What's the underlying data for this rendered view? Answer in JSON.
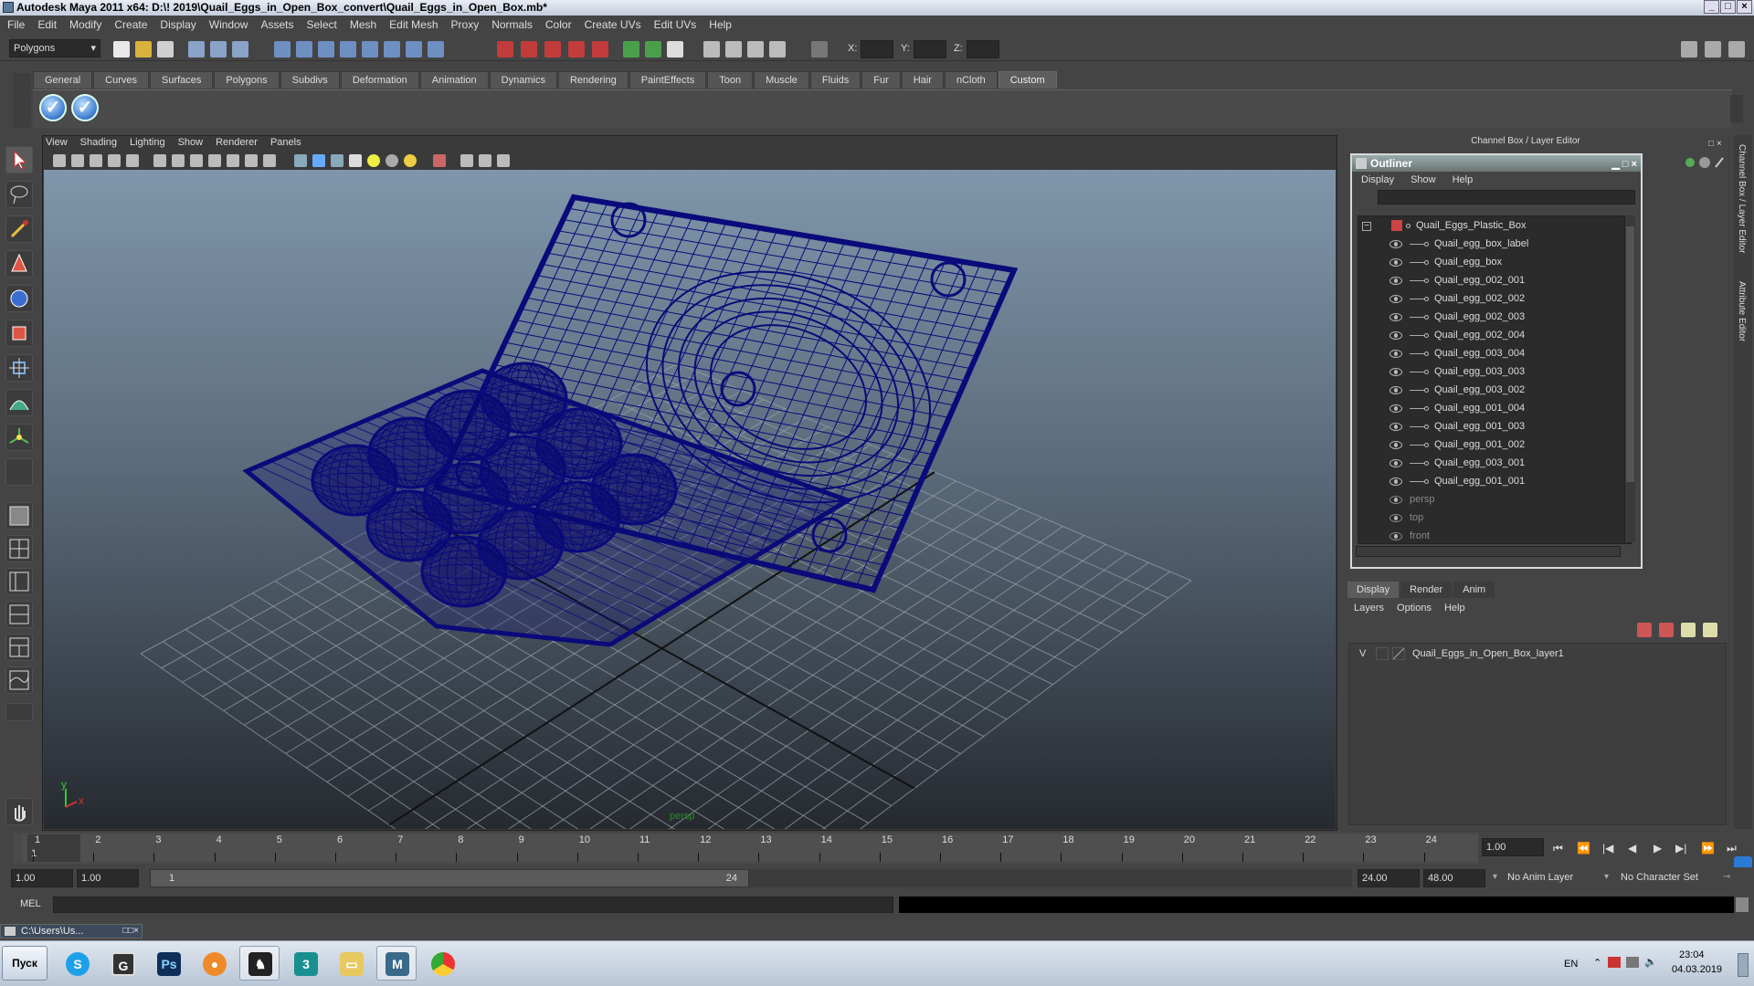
{
  "window": {
    "title": "Autodesk Maya 2011 x64: D:\\! 2019\\Quail_Eggs_in_Open_Box_convert\\Quail_Eggs_in_Open_Box.mb*"
  },
  "menubar": [
    "File",
    "Edit",
    "Modify",
    "Create",
    "Display",
    "Window",
    "Assets",
    "Select",
    "Mesh",
    "Edit Mesh",
    "Proxy",
    "Normals",
    "Color",
    "Create UVs",
    "Edit UVs",
    "Help"
  ],
  "status_line": {
    "mode_selector": "Polygons",
    "coord_x_label": "X:",
    "coord_y_label": "Y:",
    "coord_z_label": "Z:"
  },
  "shelf": {
    "tabs": [
      "General",
      "Curves",
      "Surfaces",
      "Polygons",
      "Subdivs",
      "Deformation",
      "Animation",
      "Dynamics",
      "Rendering",
      "PaintEffects",
      "Toon",
      "Muscle",
      "Fluids",
      "Fur",
      "Hair",
      "nCloth",
      "Custom"
    ],
    "active_tab": "Custom"
  },
  "viewport": {
    "menu": [
      "View",
      "Shading",
      "Lighting",
      "Show",
      "Renderer",
      "Panels"
    ],
    "camera_label": "persp",
    "axis_y": "y",
    "axis_x": "x",
    "wire_color": "#0a0a7a"
  },
  "channel_box": {
    "title": "Channel Box / Layer Editor",
    "side_tabs": [
      "Channel Box / Layer Editor",
      "Attribute Editor"
    ]
  },
  "outliner": {
    "title": "Outliner",
    "menu": [
      "Display",
      "Show",
      "Help"
    ],
    "root": "Quail_Eggs_Plastic_Box",
    "children": [
      "Quail_egg_box_label",
      "Quail_egg_box",
      "Quail_egg_002_001",
      "Quail_egg_002_002",
      "Quail_egg_002_003",
      "Quail_egg_002_004",
      "Quail_egg_003_004",
      "Quail_egg_003_003",
      "Quail_egg_003_002",
      "Quail_egg_001_004",
      "Quail_egg_001_003",
      "Quail_egg_001_002",
      "Quail_egg_003_001",
      "Quail_egg_001_001"
    ],
    "cameras": [
      "persp",
      "top",
      "front"
    ]
  },
  "layer_editor": {
    "tabs": [
      "Display",
      "Render",
      "Anim"
    ],
    "active_tab": "Display",
    "menu": [
      "Layers",
      "Options",
      "Help"
    ],
    "layer_visibility": "V",
    "layer_name": "Quail_Eggs_in_Open_Box_layer1"
  },
  "timeline": {
    "ticks": [
      "1",
      "2",
      "3",
      "4",
      "5",
      "6",
      "7",
      "8",
      "9",
      "10",
      "11",
      "12",
      "13",
      "14",
      "15",
      "16",
      "17",
      "18",
      "19",
      "20",
      "21",
      "22",
      "23",
      "24"
    ],
    "current_frame_marker": "1",
    "current_time": "1.00"
  },
  "range": {
    "start_time": "1.00",
    "playback_start": "1.00",
    "slider_start": "1",
    "slider_end": "24",
    "playback_end": "24.00",
    "end_time": "48.00",
    "anim_layer": "No Anim Layer",
    "character_set": "No Character Set"
  },
  "command_line": {
    "label": "MEL"
  },
  "mini_window": {
    "title": "C:\\Users\\Us..."
  },
  "taskbar": {
    "start_label": "Пуск",
    "language": "EN",
    "time": "23:04",
    "date": "04.03.2019"
  }
}
